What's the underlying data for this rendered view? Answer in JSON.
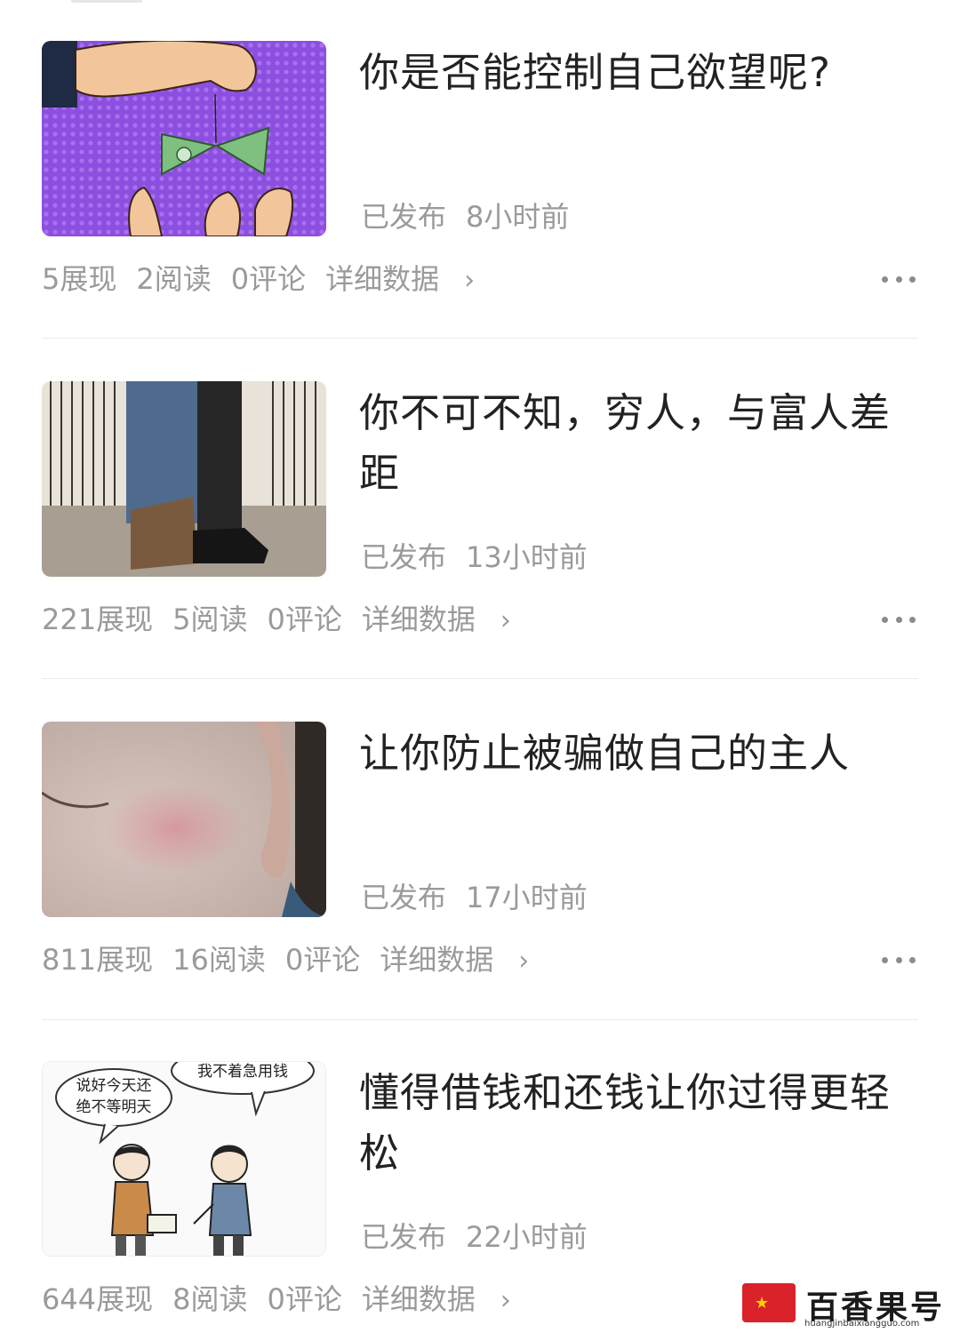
{
  "articles": [
    {
      "title": "你是否能控制自己欲望呢?",
      "status": "已发布",
      "time": "8小时前",
      "impressions": "5展现",
      "reads": "2阅读",
      "comments": "0评论",
      "detail": "详细数据",
      "thumbnail_icon": "money-bait-image"
    },
    {
      "title": "你不可不知，穷人，与富人差距",
      "status": "已发布",
      "time": "13小时前",
      "impressions": "221展现",
      "reads": "5阅读",
      "comments": "0评论",
      "detail": "详细数据",
      "thumbnail_icon": "shoes-contrast-image"
    },
    {
      "title": "让你防止被骗做自己的主人",
      "status": "已发布",
      "time": "17小时前",
      "impressions": "811展现",
      "reads": "16阅读",
      "comments": "0评论",
      "detail": "详细数据",
      "thumbnail_icon": "face-closeup-image"
    },
    {
      "title": "懂得借钱和还钱让你过得更轻松",
      "status": "已发布",
      "time": "22小时前",
      "impressions": "644展现",
      "reads": "8阅读",
      "comments": "0评论",
      "detail": "详细数据",
      "thumbnail_icon": "cartoon-lending-image",
      "thumbnail_text": {
        "bubble_left": "说好今天还 绝不等明天",
        "bubble_right": "我不着急用钱"
      }
    }
  ],
  "watermark": {
    "name": "百香果号",
    "url": "huangjinbaixiangguo.com"
  },
  "colors": {
    "text_primary": "#222222",
    "text_secondary": "#9a9a9a",
    "divider": "#ececec",
    "logo_red": "#d9222a"
  }
}
